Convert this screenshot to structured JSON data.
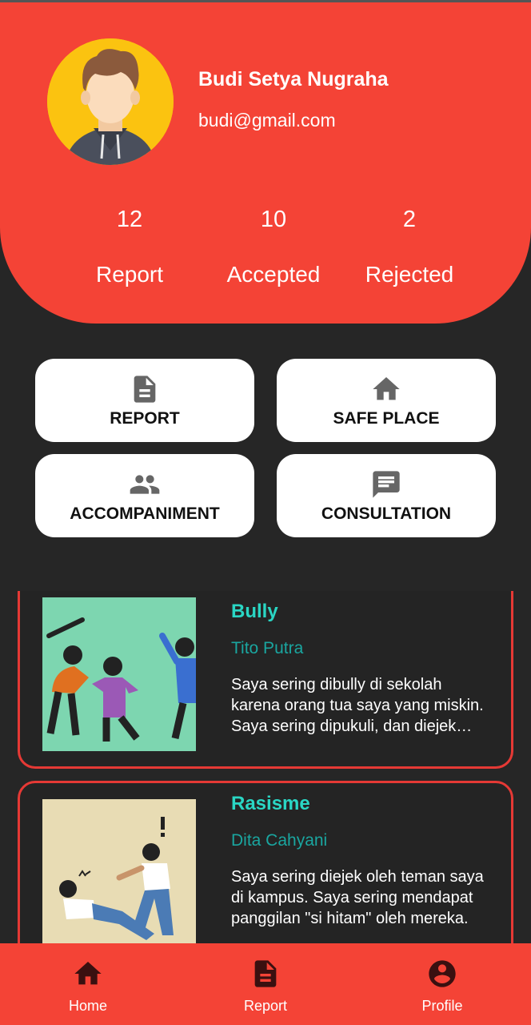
{
  "profile": {
    "name": "Budi Setya Nugraha",
    "email": "budi@gmail.com",
    "stats": [
      {
        "value": "12",
        "label": "Report"
      },
      {
        "value": "10",
        "label": "Accepted"
      },
      {
        "value": "2",
        "label": "Rejected"
      }
    ]
  },
  "menu": {
    "report": {
      "label": "REPORT",
      "icon": "document-icon"
    },
    "safe_place": {
      "label": "SAFE PLACE",
      "icon": "home-icon"
    },
    "accompaniment": {
      "label": "ACCOMPANIMENT",
      "icon": "people-icon"
    },
    "consultation": {
      "label": "CONSULTATION",
      "icon": "chat-icon"
    }
  },
  "reports": [
    {
      "title": "Bully",
      "author": "Tito Putra",
      "description": "Saya sering dibully di sekolah karena orang tua saya yang miskin. Saya sering dipukuli, dan diejek oleh teman saya."
    },
    {
      "title": "Rasisme",
      "author": "Dita Cahyani",
      "description": "Saya sering diejek oleh teman saya di kampus. Saya sering mendapat panggilan \"si hitam\" oleh mereka."
    }
  ],
  "nav": {
    "home": "Home",
    "report": "Report",
    "profile": "Profile"
  },
  "colors": {
    "primary": "#f44336",
    "background": "#262626",
    "accent": "#2ad6c4",
    "nav_icon": "#3a1010"
  }
}
